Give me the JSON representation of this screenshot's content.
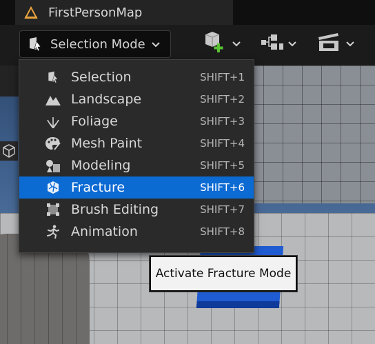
{
  "tab": {
    "title": "FirstPersonMap",
    "icon": "unreal-level-icon"
  },
  "toolbar": {
    "mode_button_label": "Selection Mode",
    "mode_button_icon": "selection-mode-icon",
    "buttons": [
      {
        "icon": "add-actor-icon"
      },
      {
        "icon": "blueprint-icon"
      },
      {
        "icon": "cinematics-icon"
      }
    ]
  },
  "menu": {
    "items": [
      {
        "label": "Selection",
        "shortcut": "SHIFT+1",
        "icon": "selection-mode-icon"
      },
      {
        "label": "Landscape",
        "shortcut": "SHIFT+2",
        "icon": "landscape-icon"
      },
      {
        "label": "Foliage",
        "shortcut": "SHIFT+3",
        "icon": "foliage-icon"
      },
      {
        "label": "Mesh Paint",
        "shortcut": "SHIFT+4",
        "icon": "mesh-paint-icon"
      },
      {
        "label": "Modeling",
        "shortcut": "SHIFT+5",
        "icon": "modeling-icon"
      },
      {
        "label": "Fracture",
        "shortcut": "SHIFT+6",
        "icon": "fracture-icon"
      },
      {
        "label": "Brush Editing",
        "shortcut": "SHIFT+7",
        "icon": "brush-editing-icon"
      },
      {
        "label": "Animation",
        "shortcut": "SHIFT+8",
        "icon": "animation-icon"
      }
    ],
    "selected_index": 5
  },
  "tooltip": {
    "text": "Activate Fracture Mode"
  },
  "colors": {
    "highlight": "#0c6ad3",
    "tab_icon": "#e8a33d",
    "add_plus": "#5bc236"
  }
}
